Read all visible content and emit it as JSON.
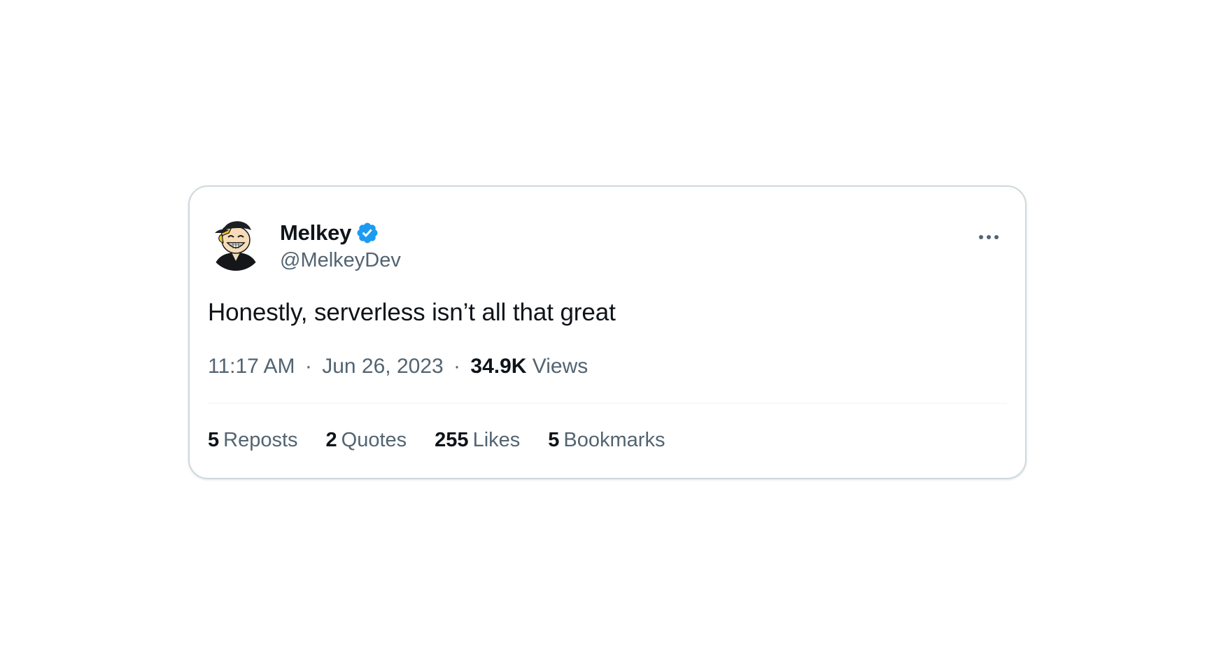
{
  "author": {
    "display_name": "Melkey",
    "handle": "@MelkeyDev",
    "verified": true,
    "avatar_icon": "cartoon-avatar-icon"
  },
  "tweet": {
    "text": "Honestly, serverless isn’t all that great",
    "time": "11:17 AM",
    "separator": "·",
    "date": "Jun 26, 2023",
    "views_count": "34.9K",
    "views_label": "Views"
  },
  "stats": [
    {
      "count": "5",
      "label": "Reposts"
    },
    {
      "count": "2",
      "label": "Quotes"
    },
    {
      "count": "255",
      "label": "Likes"
    },
    {
      "count": "5",
      "label": "Bookmarks"
    }
  ],
  "colors": {
    "primary_text": "#0f1419",
    "secondary_text": "#536471",
    "verified_blue": "#1d9bf0",
    "border": "#cfd9de",
    "divider": "#eff3f4"
  },
  "icons": {
    "verified": "verified-badge-icon",
    "more": "more-options-icon"
  }
}
